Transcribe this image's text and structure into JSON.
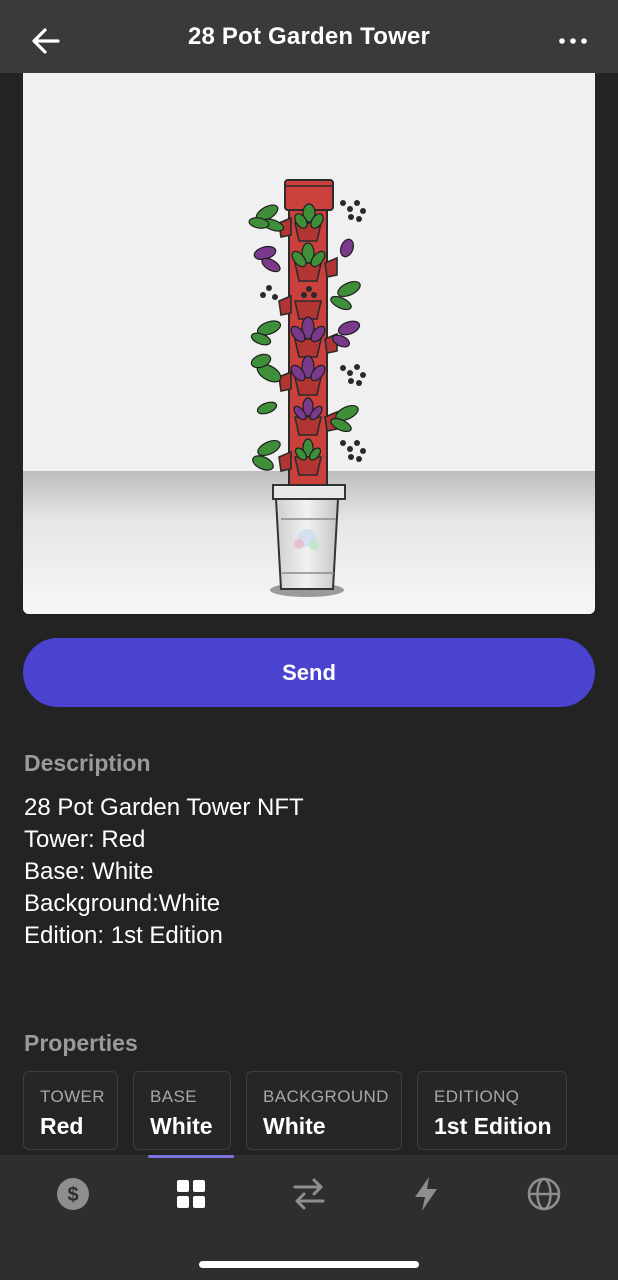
{
  "header": {
    "title": "28 Pot Garden Tower",
    "back_icon": "arrow-left-icon",
    "more_icon": "more-horizontal-icon"
  },
  "actions": {
    "send_label": "Send"
  },
  "description": {
    "heading": "Description",
    "lines": [
      "28 Pot Garden Tower NFT",
      "Tower: Red",
      "Base: White",
      "Background:White",
      "Edition: 1st Edition"
    ]
  },
  "properties": {
    "heading": "Properties",
    "items": [
      {
        "key": "TOWER",
        "value": "Red"
      },
      {
        "key": "BASE",
        "value": "White"
      },
      {
        "key": "BACKGROUND",
        "value": "White"
      },
      {
        "key": "EDITIONQ",
        "value": "1st Edition"
      }
    ]
  },
  "tabbar": {
    "tabs": [
      {
        "icon": "dollar-coin-icon",
        "active": false
      },
      {
        "icon": "grid-icon",
        "active": true
      },
      {
        "icon": "swap-arrows-icon",
        "active": false
      },
      {
        "icon": "lightning-icon",
        "active": false
      },
      {
        "icon": "globe-icon",
        "active": false
      }
    ]
  },
  "colors": {
    "background": "#232323",
    "header": "#3a3a3a",
    "accent": "#4a43d0",
    "tower_red": "#c9403c",
    "muted_text": "#9a9a9a"
  }
}
